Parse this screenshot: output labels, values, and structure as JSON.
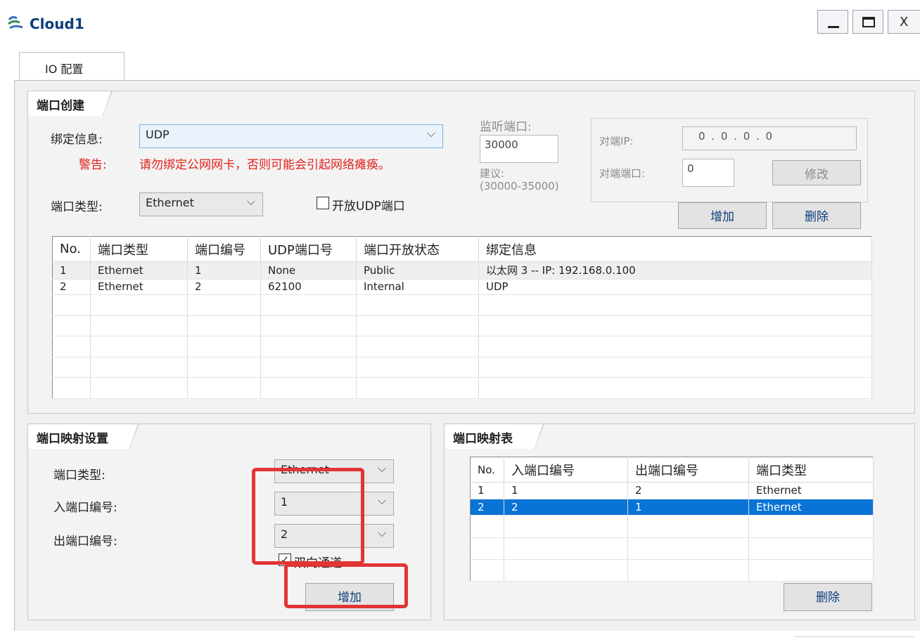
{
  "window": {
    "title": "Cloud1",
    "close_glyph": "X",
    "tab_label": "IO 配置"
  },
  "port_create": {
    "section_title": "端口创建",
    "bind_label": "绑定信息:",
    "bind_value": "UDP",
    "warning_label": "警告:",
    "warning_text": "请勿绑定公网网卡，否则可能会引起网络瘫痪。",
    "port_type_label": "端口类型:",
    "port_type_value": "Ethernet",
    "open_udp_label": "开放UDP端口",
    "listen_label": "监听端口:",
    "listen_value": "30000",
    "suggest_label": "建议:",
    "suggest_range": "(30000-35000)",
    "peer_ip_label": "对端IP:",
    "peer_ip_value": "0  .  0  .  0  .  0",
    "peer_port_label": "对端端口:",
    "peer_port_value": "0",
    "modify_button": "修改",
    "add_button": "增加",
    "delete_button": "删除",
    "table": {
      "headers": [
        "No.",
        "端口类型",
        "端口编号",
        "UDP端口号",
        "端口开放状态",
        "绑定信息"
      ],
      "rows": [
        [
          "1",
          "Ethernet",
          "1",
          "None",
          "Public",
          "以太网 3 -- IP: 192.168.0.100"
        ],
        [
          "2",
          "Ethernet",
          "2",
          "62100",
          "Internal",
          "UDP"
        ]
      ]
    }
  },
  "mapping_settings": {
    "section_title": "端口映射设置",
    "port_type_label": "端口类型:",
    "port_type_value": "Ethernet",
    "in_port_label": "入端口编号:",
    "in_port_value": "1",
    "out_port_label": "出端口编号:",
    "out_port_value": "2",
    "bidirectional_label": "双向通道",
    "bidirectional_checked": true,
    "add_button": "增加"
  },
  "mapping_table": {
    "section_title": "端口映射表",
    "headers": [
      "No.",
      "入端口编号",
      "出端口编号",
      "端口类型"
    ],
    "rows": [
      [
        "1",
        "1",
        "2",
        "Ethernet"
      ],
      [
        "2",
        "2",
        "1",
        "Ethernet"
      ]
    ],
    "selected_row": 2,
    "delete_button": "删除"
  },
  "colors": {
    "title": "#0d3d7a",
    "warning": "#e0221c",
    "selection": "#0a74d6",
    "highlight_box": "#e23434"
  }
}
